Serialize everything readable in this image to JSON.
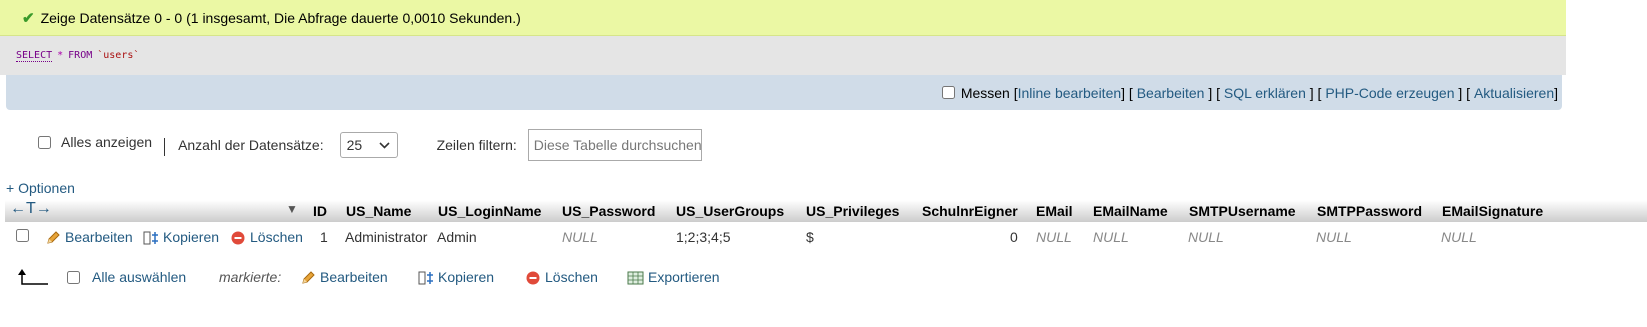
{
  "message": {
    "icon": "checkmark-icon",
    "text": "Zeige Datensätze 0 - 0 (1 insgesamt, Die Abfrage dauerte 0,0010 Sekunden.)"
  },
  "sql": {
    "select": "SELECT",
    "star": "*",
    "from": "FROM",
    "table": "`users`"
  },
  "tools": {
    "messen": "Messen",
    "inline": "Inline bearbeiten",
    "bearbeiten": "Bearbeiten",
    "sql_erklaeren": "SQL erklären",
    "php_code": "PHP-Code erzeugen",
    "aktualisieren": "Aktualisieren"
  },
  "nav": {
    "alles_anzeigen": "Alles anzeigen",
    "anzahl_label": "Anzahl der Datensätze:",
    "anzahl_value": "25",
    "filter_label": "Zeilen filtern:",
    "filter_placeholder": "Diese Tabelle durchsuchen"
  },
  "optionen": "+ Optionen",
  "table": {
    "columns": [
      "ID",
      "US_Name",
      "US_LoginName",
      "US_Password",
      "US_UserGroups",
      "US_Privileges",
      "SchulnrEigner",
      "EMail",
      "EMailName",
      "SMTPUsername",
      "SMTPPassword",
      "EMailSignature"
    ],
    "row_actions": {
      "edit": "Bearbeiten",
      "copy": "Kopieren",
      "delete": "Löschen"
    },
    "rows": [
      [
        "1",
        "Administrator",
        "Admin",
        "NULL",
        "1;2;3;4;5",
        "$",
        "0",
        "NULL",
        "NULL",
        "NULL",
        "NULL",
        "NULL"
      ]
    ]
  },
  "bottom": {
    "alle_auswaehlen": "Alle auswählen",
    "markierte": "markierte:",
    "bearbeiten": "Bearbeiten",
    "kopieren": "Kopieren",
    "loeschen": "Löschen",
    "exportieren": "Exportieren"
  },
  "colors": {
    "success_bg": "#ebf8a4",
    "link": "#235a81",
    "sql_bg": "#e5e5e5",
    "tools_bg": "#d0dce8"
  }
}
